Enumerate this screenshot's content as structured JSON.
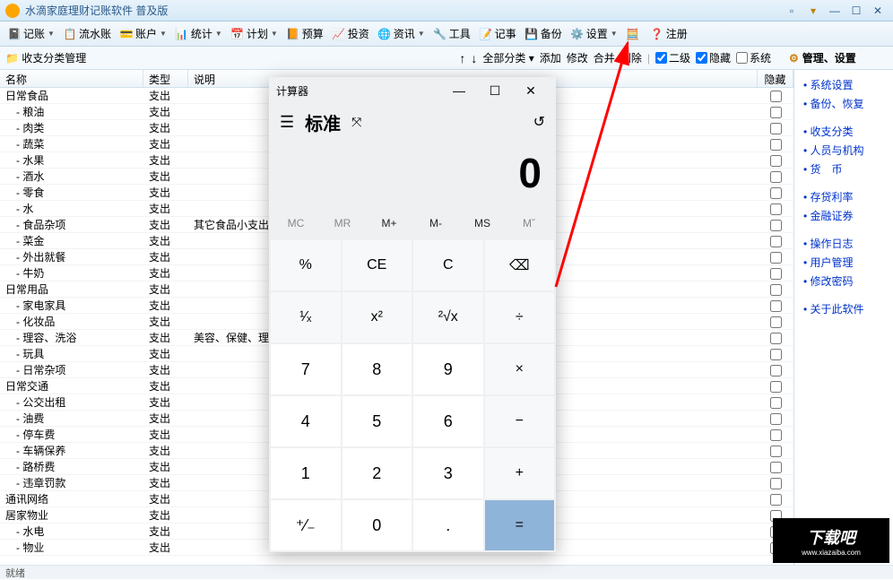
{
  "window": {
    "title": "水滴家庭理财记账软件  普及版"
  },
  "toolbar": [
    {
      "icon": "📓",
      "label": "记账",
      "drop": true
    },
    {
      "icon": "📋",
      "label": "流水账",
      "drop": false
    },
    {
      "icon": "💳",
      "label": "账户",
      "drop": true
    },
    {
      "icon": "📊",
      "label": "统计",
      "drop": true
    },
    {
      "icon": "📅",
      "label": "计划",
      "drop": true
    },
    {
      "icon": "📙",
      "label": "预算",
      "drop": false
    },
    {
      "icon": "📈",
      "label": "投资",
      "drop": false
    },
    {
      "icon": "🌐",
      "label": "资讯",
      "drop": true
    },
    {
      "icon": "🔧",
      "label": "工具",
      "drop": false
    },
    {
      "icon": "📝",
      "label": "记事",
      "drop": false
    },
    {
      "icon": "💾",
      "label": "备份",
      "drop": false
    },
    {
      "icon": "⚙️",
      "label": "设置",
      "drop": true
    },
    {
      "icon": "🧮",
      "label": "",
      "drop": false
    },
    {
      "icon": "❓",
      "label": "注册",
      "drop": false
    }
  ],
  "subbar": {
    "panel_title": "收支分类管理",
    "actions": [
      "全部分类",
      "添加",
      "修改",
      "合并",
      "删除"
    ],
    "checks": [
      {
        "label": "二级",
        "checked": true
      },
      {
        "label": "隐藏",
        "checked": true
      },
      {
        "label": "系统",
        "checked": false
      }
    ],
    "right_title": "管理、设置"
  },
  "grid": {
    "headers": {
      "name": "名称",
      "type": "类型",
      "desc": "说明",
      "hide": "隐藏"
    },
    "rows": [
      {
        "name": "日常食品",
        "sub": false,
        "type": "支出",
        "desc": ""
      },
      {
        "name": "- 粮油",
        "sub": true,
        "type": "支出",
        "desc": ""
      },
      {
        "name": "- 肉类",
        "sub": true,
        "type": "支出",
        "desc": ""
      },
      {
        "name": "- 蔬菜",
        "sub": true,
        "type": "支出",
        "desc": ""
      },
      {
        "name": "- 水果",
        "sub": true,
        "type": "支出",
        "desc": ""
      },
      {
        "name": "- 酒水",
        "sub": true,
        "type": "支出",
        "desc": ""
      },
      {
        "name": "- 零食",
        "sub": true,
        "type": "支出",
        "desc": ""
      },
      {
        "name": "- 水",
        "sub": true,
        "type": "支出",
        "desc": ""
      },
      {
        "name": "- 食品杂项",
        "sub": true,
        "type": "支出",
        "desc": "其它食品小支出"
      },
      {
        "name": "- 菜金",
        "sub": true,
        "type": "支出",
        "desc": ""
      },
      {
        "name": "- 外出就餐",
        "sub": true,
        "type": "支出",
        "desc": ""
      },
      {
        "name": "- 牛奶",
        "sub": true,
        "type": "支出",
        "desc": ""
      },
      {
        "name": "日常用品",
        "sub": false,
        "type": "支出",
        "desc": ""
      },
      {
        "name": "- 家电家具",
        "sub": true,
        "type": "支出",
        "desc": ""
      },
      {
        "name": "- 化妆品",
        "sub": true,
        "type": "支出",
        "desc": ""
      },
      {
        "name": "- 理容、洗浴",
        "sub": true,
        "type": "支出",
        "desc": "美容、保健、理发"
      },
      {
        "name": "- 玩具",
        "sub": true,
        "type": "支出",
        "desc": ""
      },
      {
        "name": "- 日常杂项",
        "sub": true,
        "type": "支出",
        "desc": ""
      },
      {
        "name": "日常交通",
        "sub": false,
        "type": "支出",
        "desc": ""
      },
      {
        "name": "- 公交出租",
        "sub": true,
        "type": "支出",
        "desc": ""
      },
      {
        "name": "- 油费",
        "sub": true,
        "type": "支出",
        "desc": ""
      },
      {
        "name": "- 停车费",
        "sub": true,
        "type": "支出",
        "desc": ""
      },
      {
        "name": "- 车辆保养",
        "sub": true,
        "type": "支出",
        "desc": ""
      },
      {
        "name": "- 路桥费",
        "sub": true,
        "type": "支出",
        "desc": ""
      },
      {
        "name": "- 违章罚款",
        "sub": true,
        "type": "支出",
        "desc": ""
      },
      {
        "name": "通讯网络",
        "sub": false,
        "type": "支出",
        "desc": ""
      },
      {
        "name": "居家物业",
        "sub": false,
        "type": "支出",
        "desc": ""
      },
      {
        "name": "- 水电",
        "sub": true,
        "type": "支出",
        "desc": ""
      },
      {
        "name": "- 物业",
        "sub": true,
        "type": "支出",
        "desc": ""
      }
    ]
  },
  "sidebar": [
    [
      "系统设置",
      "备份、恢复"
    ],
    [
      "收支分类",
      "人员与机构",
      "货　币"
    ],
    [
      "存贷利率",
      "金融证券"
    ],
    [
      "操作日志",
      "用户管理",
      "修改密码"
    ],
    [
      "关于此软件"
    ]
  ],
  "status": "就绪",
  "calc": {
    "title": "计算器",
    "mode": "标准",
    "display": "0",
    "mem": [
      "MC",
      "MR",
      "M+",
      "M-",
      "MS",
      "Mˇ"
    ],
    "buttons": [
      [
        "%",
        "CE",
        "C",
        "⌫"
      ],
      [
        "¹⁄ₓ",
        "x²",
        "²√x",
        "÷"
      ],
      [
        "7",
        "8",
        "9",
        "×"
      ],
      [
        "4",
        "5",
        "6",
        "−"
      ],
      [
        "1",
        "2",
        "3",
        "+"
      ],
      [
        "⁺⁄₋",
        "0",
        ".",
        "="
      ]
    ]
  },
  "watermark": {
    "text": "下载吧",
    "url": "www.xiazaiba.com"
  }
}
